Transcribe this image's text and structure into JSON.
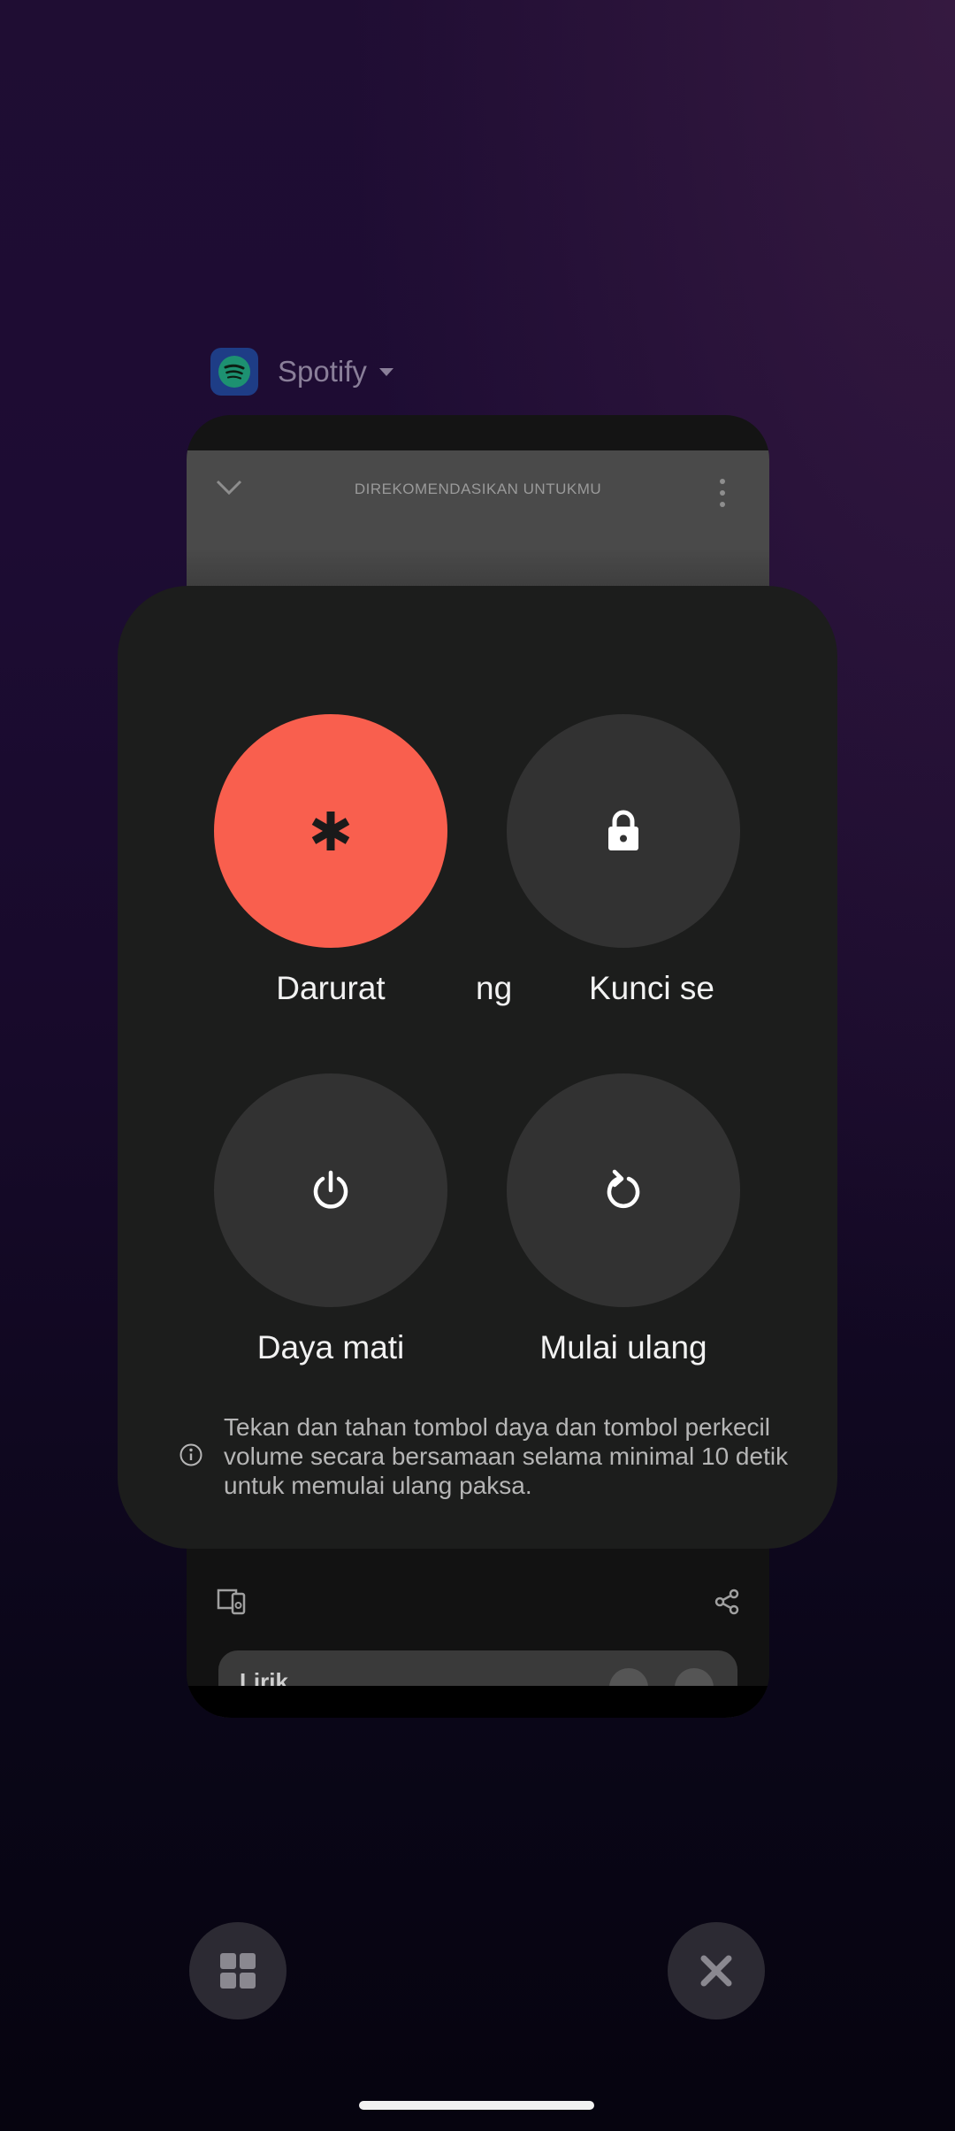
{
  "app": {
    "name": "Spotify",
    "card_title": "DIREKOMENDASIKAN UNTUKMU",
    "lyrics_label": "Lirik"
  },
  "power_menu": {
    "buttons": [
      {
        "id": "emergency",
        "label": "Darurat",
        "icon": "asterisk-icon"
      },
      {
        "id": "lock",
        "label": "Kunci se",
        "icon": "lock-icon"
      },
      {
        "id": "power_off",
        "label": "Daya mati",
        "icon": "power-icon"
      },
      {
        "id": "restart",
        "label": "Mulai ulang",
        "icon": "restart-icon"
      }
    ],
    "partial_label": "ng",
    "info": "Tekan dan tahan tombol daya dan tombol perkecil volume secara bersamaan selama minimal 10 detik untuk memulai ulang paksa."
  },
  "colors": {
    "emergency": "#f95f4e",
    "dialog_bg": "#1c1d1c",
    "button_bg": "#323232"
  },
  "bottom_controls": {
    "left_icon": "grid-icon",
    "right_icon": "close-icon"
  }
}
